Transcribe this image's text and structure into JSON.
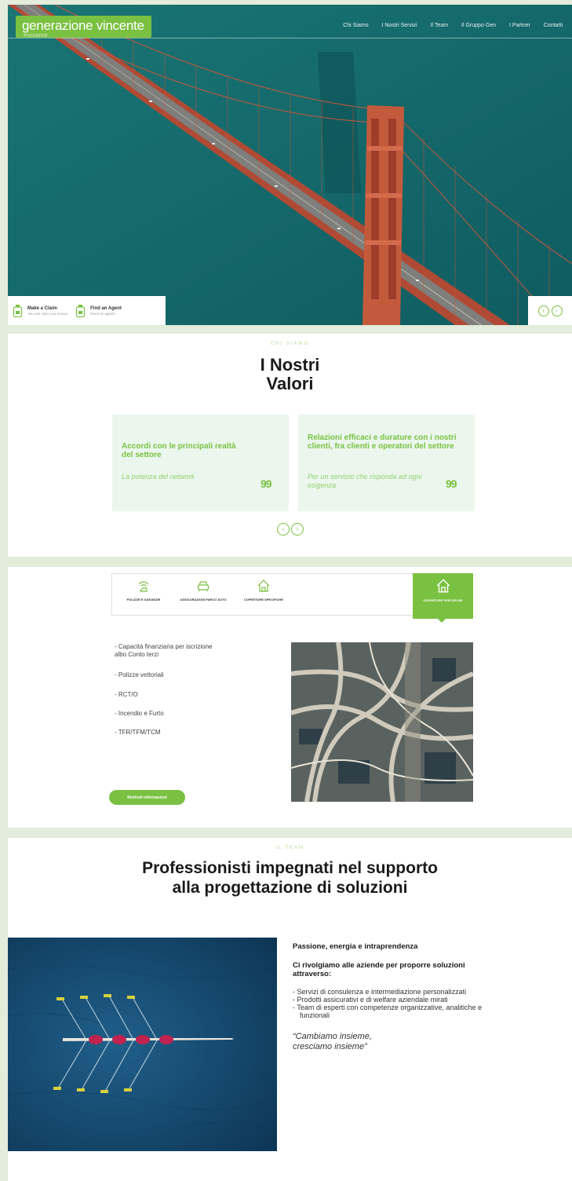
{
  "header": {
    "brand": "generazione vincente",
    "brand_sub": "Insurance",
    "nav": [
      "Chi Siamo",
      "I Nostri Servizi",
      "Il Team",
      "Il Gruppo Gen",
      "I Partner",
      "Contatti"
    ]
  },
  "hero": {
    "actions": [
      {
        "title": "Make a Claim",
        "subtitle": "You can claim you money"
      },
      {
        "title": "Find an Agent",
        "subtitle": "Need an agent?"
      }
    ]
  },
  "valori": {
    "eyebrow": "CHI SIAMO",
    "title_line1": "I Nostri",
    "title_line2": "Valori",
    "cards": [
      {
        "title": "Accordi con le principali realtà del settore",
        "subtitle": "La potenza del network"
      },
      {
        "title": "Relazioni efficaci e durature con i nostri clienti, fra clienti e operatori del settore",
        "subtitle": "Per un servizio che risponda ad ogni esigenza"
      }
    ]
  },
  "servizi": {
    "tabs": [
      {
        "label": "POLIZZE E GARANZIE",
        "icon": "wifi-hand-icon"
      },
      {
        "label": "ASSICURAZIONI PARCO AUTO",
        "icon": "car-icon"
      },
      {
        "label": "COPERTURE SPECIFICHE",
        "icon": "house-icon"
      },
      {
        "label": "COPERTURE SPECIFICHE",
        "icon": "house-icon",
        "active": true
      }
    ],
    "list": [
      "- Capacità finanziaria per iscrizione albo Conto terzi",
      "- Polizze vettoriali",
      "- RCT/O",
      "- Incendio e Furto",
      "- TFR/TFM/TCM"
    ],
    "button": "Richiedi informazioni"
  },
  "team": {
    "eyebrow": "IL TEAM",
    "title_line1": "Professionisti impegnati nel supporto",
    "title_line2": "alla progettazione di soluzioni",
    "heading1": "Passione, energia e intraprendenza",
    "heading2": "Ci rivolgiamo alle aziende per proporre soluzioni attraverso:",
    "items": [
      "- Servizi di consulenza e intermediazione personalizzati",
      "- Prodotti assicurativi e di welfare aziendale mirati",
      "- Team di esperti con competenze organizzative, analitiche e funzionali"
    ],
    "quote_line1": "“Cambiamo insieme,",
    "quote_line2": "cresciamo insieme”"
  },
  "colors": {
    "accent": "#7ac142",
    "card_bg": "#ebf7ed",
    "page_bg": "#e4ecdc",
    "sea": "#17696a"
  }
}
